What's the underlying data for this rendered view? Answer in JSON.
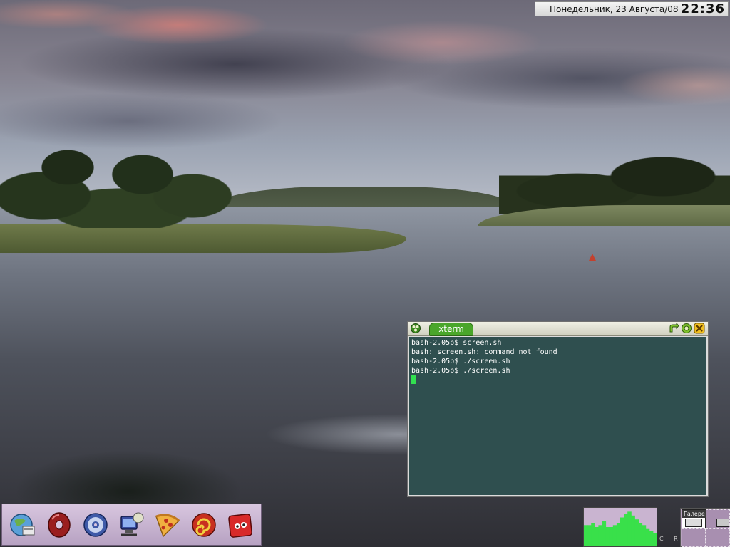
{
  "desktop": {
    "wallpaper": "river landscape at dusk",
    "accent_color": "#4aa62a"
  },
  "clock": {
    "date": "Понедельник, 23 Августа/08",
    "time": "22:36"
  },
  "xterm": {
    "title": "xterm",
    "menu_icon": "flower-menu-icon",
    "buttons": {
      "shade": "arrow-curve-icon",
      "iconify": "circle-icon",
      "close": "close-icon"
    },
    "lines": [
      "bash-2.05b$ screen.sh",
      "bash: screen.sh: command not found",
      "bash-2.05b$ ./screen.sh",
      "bash-2.05b$ ./screen.sh"
    ],
    "background": "#2f4f4f",
    "cursor_color": "#32e050"
  },
  "dock": {
    "items": [
      {
        "name": "file-manager",
        "icon": "file-manager-icon"
      },
      {
        "name": "music-player",
        "icon": "donut-icon"
      },
      {
        "name": "disc-burner",
        "icon": "disc-icon"
      },
      {
        "name": "remote-desktop",
        "icon": "monitor-icon"
      },
      {
        "name": "pizza-app",
        "icon": "pizza-icon"
      },
      {
        "name": "graphics-editor",
        "icon": "spiral-icon"
      },
      {
        "name": "security-app",
        "icon": "red-box-icon"
      }
    ]
  },
  "pager": {
    "label": "Галере"
  },
  "cpu_monitor": {
    "levels": [
      0.55,
      0.55,
      0.6,
      0.5,
      0.55,
      0.65,
      0.5,
      0.5,
      0.55,
      0.6,
      0.75,
      0.85,
      0.9,
      0.8,
      0.7,
      0.6,
      0.55,
      0.45,
      0.4,
      0.35
    ]
  },
  "footer_text": "C R"
}
